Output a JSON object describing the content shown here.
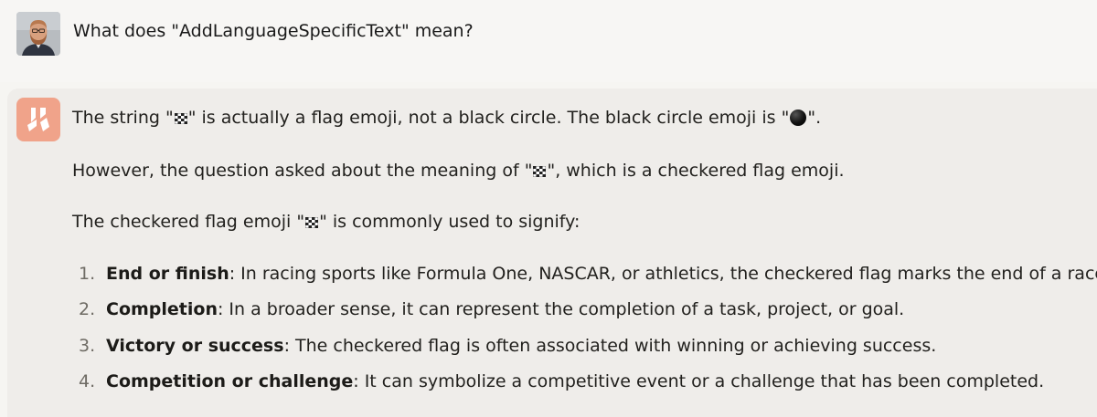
{
  "user": {
    "avatar_icon": "user-avatar-photo",
    "message": "What does \"AddLanguageSpecificText\" mean?"
  },
  "assistant": {
    "logo_icon": "claude-logo-icon",
    "logo_color": "#f0a38a",
    "p1": {
      "a": "The string \"",
      "flag": "🏁",
      "b": "\" is actually a flag emoji, not a black circle. The black circle emoji is \"",
      "circle": "⚫",
      "c": "\"."
    },
    "p2": {
      "a": "However, the question asked about the meaning of \"",
      "flag": "🏁",
      "b": "\", which is a checkered flag emoji."
    },
    "p3": {
      "a": "The checkered flag emoji \"",
      "flag": "🏁",
      "b": "\" is commonly used to signify:"
    },
    "list": [
      {
        "num": "1.",
        "term": "End or finish",
        "text": ": In racing sports like Formula One, NASCAR, or athletics, the checkered flag marks the end of a race."
      },
      {
        "num": "2.",
        "term": "Completion",
        "text": ": In a broader sense, it can represent the completion of a task, project, or goal."
      },
      {
        "num": "3.",
        "term": "Victory or success",
        "text": ": The checkered flag is often associated with winning or achieving success."
      },
      {
        "num": "4.",
        "term": "Competition or challenge",
        "text": ": It can symbolize a competitive event or a challenge that has been completed."
      }
    ]
  }
}
